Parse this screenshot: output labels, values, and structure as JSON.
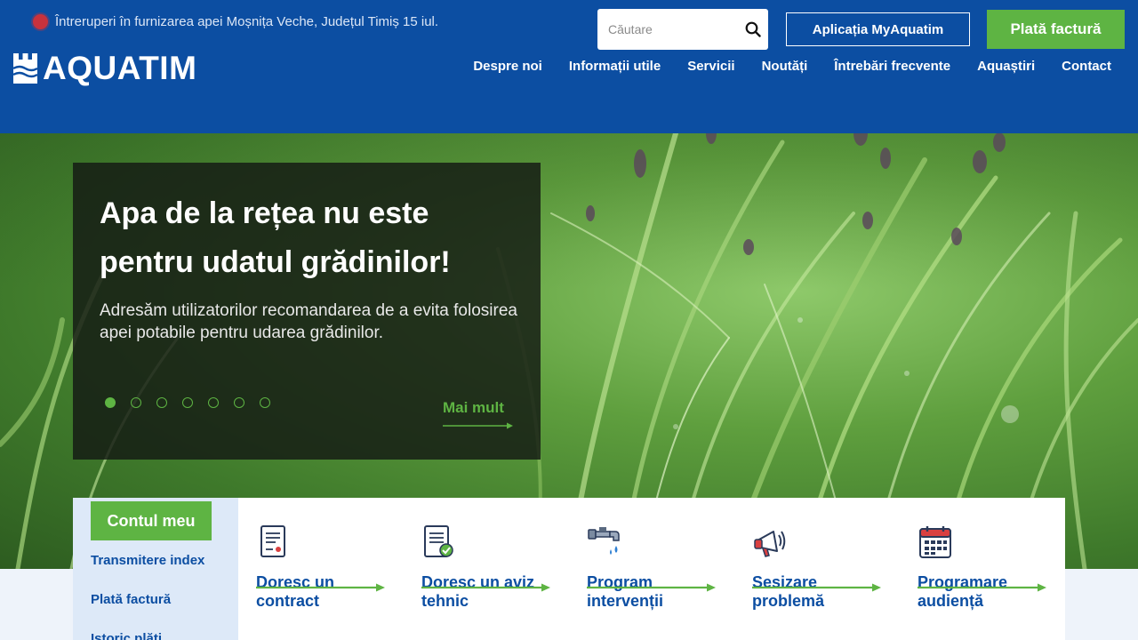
{
  "alert": {
    "text": "Întreruperi în furnizarea apei Moșnița Veche, Județul Timiș 15 iul."
  },
  "logo": {
    "text": "AQUATIM"
  },
  "search": {
    "placeholder": "Căutare"
  },
  "header": {
    "app_button": "Aplicația MyAquatim",
    "pay_button": "Plată factură"
  },
  "nav": [
    {
      "label": "Despre noi"
    },
    {
      "label": "Informații utile"
    },
    {
      "label": "Servicii"
    },
    {
      "label": "Noutăți"
    },
    {
      "label": "Întrebări frecvente"
    },
    {
      "label": "Aquaștiri"
    },
    {
      "label": "Contact"
    }
  ],
  "slide": {
    "title": "Apa de la rețea nu este pentru udatul grădinilor!",
    "text": "Adresăm utilizatorilor recomandarea de a evita folosirea apei potabile pentru udarea grădinilor.",
    "more": "Mai mult",
    "dots_total": 7,
    "active_dot": 1
  },
  "account": {
    "title": "Contul meu",
    "links": [
      {
        "label": "Transmitere index"
      },
      {
        "label": "Plată factură"
      },
      {
        "label": "Istoric plăți"
      }
    ]
  },
  "services": [
    {
      "label": "Doresc un contract",
      "icon": "contract-document-icon"
    },
    {
      "label": "Doresc un aviz tehnic",
      "icon": "technical-document-icon"
    },
    {
      "label": "Program intervenții",
      "icon": "water-tap-icon"
    },
    {
      "label": "Sesizare problemă",
      "icon": "megaphone-icon"
    },
    {
      "label": "Programare audiență",
      "icon": "calendar-icon"
    }
  ],
  "colors": {
    "brand_blue": "#0c4ea2",
    "accent_green": "#5eb443",
    "alert_red": "#c8323d"
  }
}
